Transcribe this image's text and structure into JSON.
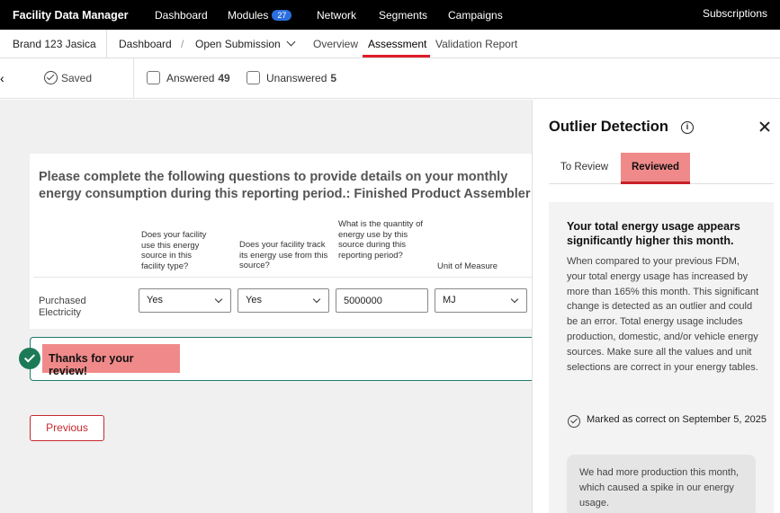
{
  "topnav": {
    "brand": "Facility Data Manager",
    "items": [
      {
        "label": "Dashboard"
      },
      {
        "label": "Modules",
        "badge": "27"
      },
      {
        "label": "Network"
      },
      {
        "label": "Segments"
      },
      {
        "label": "Campaigns"
      }
    ],
    "subscriptions": "Subscriptions"
  },
  "breadcrumb": {
    "brand": "Brand 123 Jasica",
    "dashboard": "Dashboard",
    "submission": "Open Submission",
    "tabs": [
      {
        "label": "Overview"
      },
      {
        "label": "Assessment",
        "active": true
      },
      {
        "label": "Validation Report"
      }
    ]
  },
  "status": {
    "back": "‹",
    "saved": "Saved",
    "answered_label": "Answered",
    "answered_count": "49",
    "unanswered_label": "Unanswered",
    "unanswered_count": "5"
  },
  "question": {
    "title": "Please complete the following questions to provide details on your monthly energy consumption during this reporting period.: Finished Product Assembler",
    "columns": [
      "Does your facility use this energy source in this facility type?",
      "Does your facility track its energy use from this source?",
      "What is the quantity of energy use by this source during this reporting period?",
      "Unit of Measure"
    ],
    "row": {
      "label": "Purchased Electricity",
      "uses_source": "Yes",
      "tracks_source": "Yes",
      "quantity": "5000000",
      "unit": "MJ"
    }
  },
  "review_banner": {
    "text": "Thanks for your review!"
  },
  "previous_button": "Previous",
  "panel": {
    "title": "Outlier Detection",
    "info_glyph": "i",
    "tabs": [
      "To Review",
      "Reviewed"
    ],
    "active_tab": "Reviewed",
    "card": {
      "heading": "Your total energy usage appears significantly higher this month.",
      "body": "When compared to your previous FDM, your total energy usage has increased by more than 165% this month. This significant change is detected as an outlier and could be an error. Total energy usage includes production, domestic, and/or vehicle energy sources.  Make sure all the values and unit selections are correct in your energy tables.",
      "marked": "Marked as correct on September 5, 2025",
      "comment": "We had more production this month, which caused a spike in our energy usage."
    }
  },
  "colors": {
    "accent_red": "#e01c2a",
    "highlight_pink": "#f08a8a",
    "success_green": "#1c7a57",
    "badge_blue": "#2c6fe0"
  }
}
